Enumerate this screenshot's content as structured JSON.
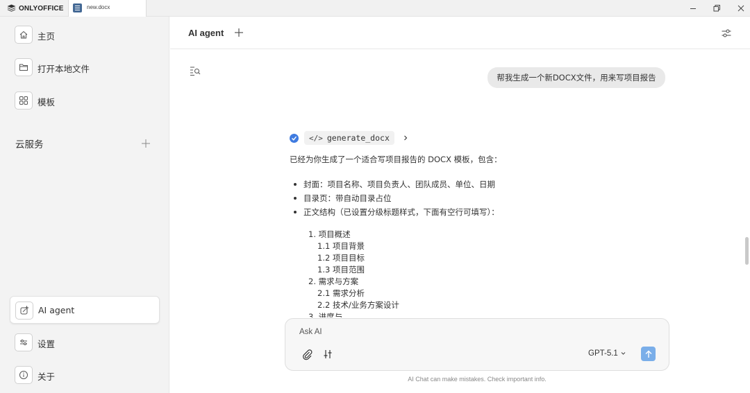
{
  "titlebar": {
    "app_name": "ONLYOFFICE",
    "tab_label": "new.docx"
  },
  "sidebar": {
    "items": [
      {
        "label": "主页",
        "icon": "home-icon"
      },
      {
        "label": "打开本地文件",
        "icon": "folder-icon"
      },
      {
        "label": "模板",
        "icon": "grid-icon"
      }
    ],
    "cloud_label": "云服务",
    "bottom_items": [
      {
        "label": "AI agent",
        "icon": "ai-agent-icon",
        "active": true
      },
      {
        "label": "设置",
        "icon": "sliders-icon"
      },
      {
        "label": "关于",
        "icon": "info-icon"
      }
    ]
  },
  "main": {
    "title": "AI agent"
  },
  "chat": {
    "user_message": "帮我生成一个新DOCX文件，用来写项目报告",
    "tool_name": "generate_docx",
    "reply_intro": "已经为你生成了一个适合写项目报告的 DOCX 模板，包含：",
    "bullets": [
      "封面：项目名称、项目负责人、团队成员、单位、日期",
      "目录页：带自动目录占位",
      "正文结构（已设置分级标题样式，下面有空行可填写）："
    ],
    "toc": [
      "1. 项目概述",
      "1.1 项目背景",
      "1.2 项目目标",
      "1.3 项目范围",
      "2. 需求与方案",
      "2.1 需求分析",
      "2.2 技术/业务方案设计",
      "3. 进度与"
    ]
  },
  "composer": {
    "placeholder": "Ask AI",
    "model": "GPT-5.1",
    "disclaimer": "AI Chat can make mistakes. Check important info."
  },
  "colors": {
    "accent": "#3f7be0",
    "send_button": "#7aaee9",
    "sidebar_bg": "#f3f3f3"
  }
}
